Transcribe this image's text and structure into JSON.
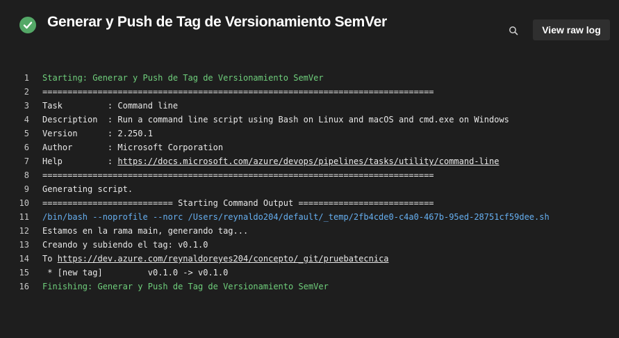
{
  "header": {
    "title": "Generar y Push de Tag de Versionamiento SemVer",
    "status": "success",
    "status_color": "#54a867",
    "search_icon": "search-icon",
    "view_raw_label": "View raw log"
  },
  "log": {
    "lines": [
      {
        "n": "1",
        "segments": [
          {
            "t": "Starting: Generar y Push de Tag de Versionamiento SemVer",
            "style": "green"
          }
        ]
      },
      {
        "n": "2",
        "segments": [
          {
            "t": "==============================================================================",
            "style": "normal"
          }
        ]
      },
      {
        "n": "3",
        "segments": [
          {
            "t": "Task         : Command line",
            "style": "normal"
          }
        ]
      },
      {
        "n": "4",
        "segments": [
          {
            "t": "Description  : Run a command line script using Bash on Linux and macOS and cmd.exe on Windows",
            "style": "normal"
          }
        ]
      },
      {
        "n": "5",
        "segments": [
          {
            "t": "Version      : 2.250.1",
            "style": "normal"
          }
        ]
      },
      {
        "n": "6",
        "segments": [
          {
            "t": "Author       : Microsoft Corporation",
            "style": "normal"
          }
        ]
      },
      {
        "n": "7",
        "segments": [
          {
            "t": "Help         : ",
            "style": "normal"
          },
          {
            "t": "https://docs.microsoft.com/azure/devops/pipelines/tasks/utility/command-line",
            "style": "link"
          }
        ]
      },
      {
        "n": "8",
        "segments": [
          {
            "t": "==============================================================================",
            "style": "normal"
          }
        ]
      },
      {
        "n": "9",
        "segments": [
          {
            "t": "Generating script.",
            "style": "normal"
          }
        ]
      },
      {
        "n": "10",
        "segments": [
          {
            "t": "========================== Starting Command Output ===========================",
            "style": "normal"
          }
        ]
      },
      {
        "n": "11",
        "segments": [
          {
            "t": "/bin/bash --noprofile --norc /Users/reynaldo204/default/_temp/2fb4cde0-c4a0-467b-95ed-28751cf59dee.sh",
            "style": "blue"
          }
        ]
      },
      {
        "n": "12",
        "segments": [
          {
            "t": "Estamos en la rama main, generando tag...",
            "style": "normal"
          }
        ]
      },
      {
        "n": "13",
        "segments": [
          {
            "t": "Creando y subiendo el tag: v0.1.0",
            "style": "normal"
          }
        ]
      },
      {
        "n": "14",
        "segments": [
          {
            "t": "To ",
            "style": "normal"
          },
          {
            "t": "https://dev.azure.com/reynaldoreyes204/concepto/_git/pruebatecnica",
            "style": "link"
          }
        ]
      },
      {
        "n": "15",
        "segments": [
          {
            "t": " * [new tag]         v0.1.0 -> v0.1.0",
            "style": "normal"
          }
        ]
      },
      {
        "n": "16",
        "segments": [
          {
            "t": "Finishing: Generar y Push de Tag de Versionamiento SemVer",
            "style": "green"
          }
        ]
      }
    ]
  }
}
